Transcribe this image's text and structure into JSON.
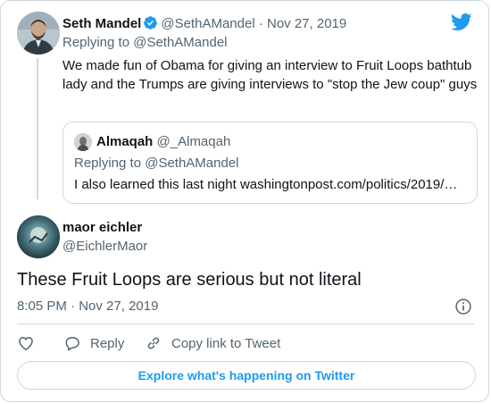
{
  "parent_tweet": {
    "name": "Seth Mandel",
    "handle": "@SethAMandel",
    "separator": "·",
    "date": "Nov 27, 2019",
    "replying_prefix": "Replying to",
    "replying_handle": "@SethAMandel",
    "text": "We made fun of Obama for giving an interview to Fruit Loops bathtub lady and the Trumps are giving interviews to \"stop the Jew coup\" guys"
  },
  "quoted_tweet": {
    "name": "Almaqah",
    "handle": "@_Almaqah",
    "replying_prefix": "Replying to",
    "replying_handle": "@SethAMandel",
    "text": "I also learned this last night washingtonpost.com/politics/2019/…"
  },
  "main_tweet": {
    "name": "maor eichler",
    "handle": "@EichlerMaor",
    "text": "These Fruit Loops are serious but not literal",
    "time": "8:05 PM",
    "separator": "·",
    "date": "Nov 27, 2019"
  },
  "actions": {
    "reply_label": "Reply",
    "copy_label": "Copy link to Tweet"
  },
  "explore_label": "Explore what's happening on Twitter",
  "icons": {
    "brand": "twitter-bird-icon",
    "verified": "verified-badge-icon",
    "like": "heart-icon",
    "reply": "speech-bubble-icon",
    "copy": "link-icon",
    "info": "info-icon"
  },
  "colors": {
    "accent": "#1d9bf0",
    "muted": "#536471",
    "text": "#0f1419",
    "border": "#cfd9de"
  }
}
